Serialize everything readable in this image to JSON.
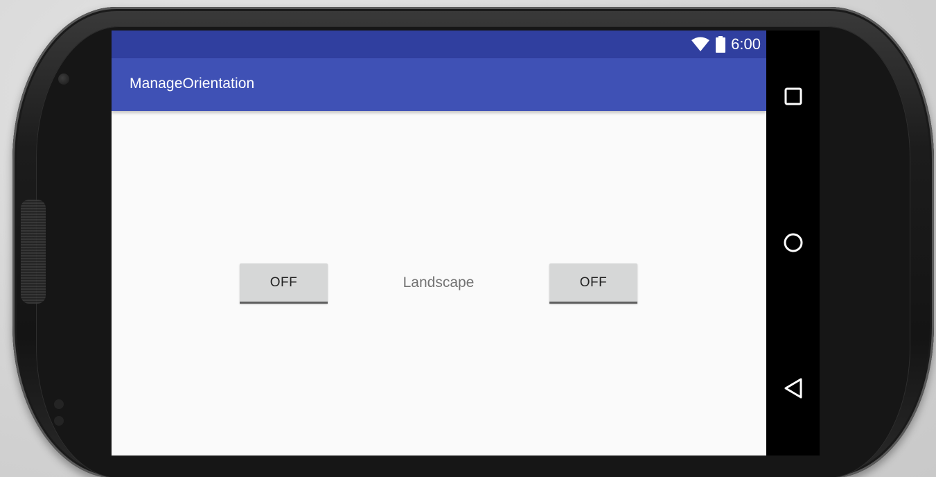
{
  "status_bar": {
    "time": "6:00",
    "icons": [
      "wifi-icon",
      "battery-icon"
    ],
    "color": "#303f9f"
  },
  "app_bar": {
    "title": "ManageOrientation",
    "color": "#3f51b5"
  },
  "main": {
    "left_toggle_label": "OFF",
    "right_toggle_label": "OFF",
    "orientation_label": "Landscape"
  },
  "nav_bar": {
    "buttons": [
      "recents-icon",
      "home-icon",
      "back-icon"
    ]
  },
  "colors": {
    "screen_background": "#fafafa",
    "toggle_background": "#d6d7d7",
    "label_text": "#737373"
  }
}
